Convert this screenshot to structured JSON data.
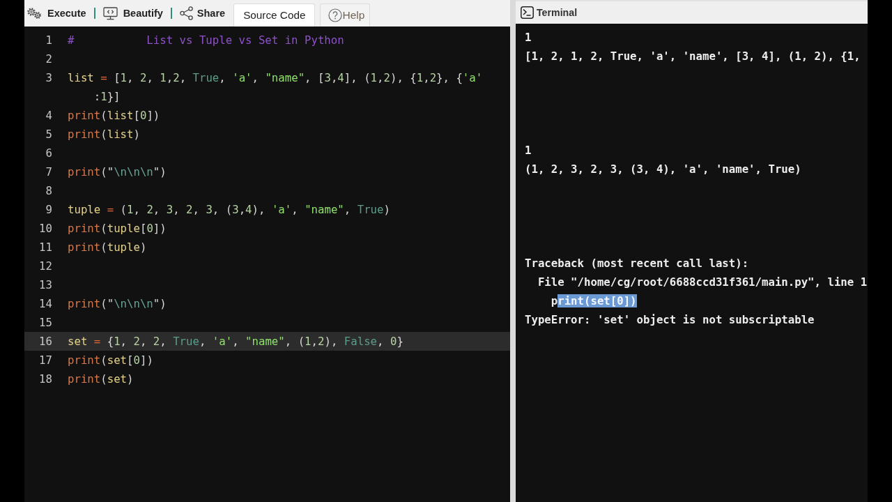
{
  "toolbar": {
    "buttons": [
      {
        "kind": "execute",
        "label": "Execute"
      },
      {
        "kind": "beautify",
        "label": "Beautify"
      },
      {
        "kind": "share",
        "label": "Share"
      }
    ],
    "tabs": [
      {
        "kind": "source",
        "label": "Source Code",
        "selected": true
      },
      {
        "kind": "help",
        "label": "Help",
        "selected": false
      }
    ]
  },
  "editor": {
    "lines": [
      {
        "number": "1",
        "active": false,
        "tokens": [
          {
            "kind": "comment",
            "text": "#           List vs Tuple vs Set in Python"
          }
        ]
      },
      {
        "number": "2",
        "active": false
      },
      {
        "number": "3",
        "active": false,
        "tokens": [
          {
            "kind": "variable",
            "text": "list"
          },
          {
            "kind": "operator",
            "text": " = "
          },
          {
            "kind": "punctuation",
            "text": "["
          },
          {
            "kind": "number",
            "text": "1"
          },
          {
            "kind": "punctuation",
            "text": ", "
          },
          {
            "kind": "number",
            "text": "2"
          },
          {
            "kind": "punctuation",
            "text": ", "
          },
          {
            "kind": "number",
            "text": "1"
          },
          {
            "kind": "punctuation",
            "text": ","
          },
          {
            "kind": "number",
            "text": "2"
          },
          {
            "kind": "punctuation",
            "text": ", "
          },
          {
            "kind": "constant",
            "text": "True"
          },
          {
            "kind": "punctuation",
            "text": ", "
          },
          {
            "kind": "string",
            "text": "'a'"
          },
          {
            "kind": "punctuation",
            "text": ", "
          },
          {
            "kind": "string",
            "text": "\"name\""
          },
          {
            "kind": "punctuation",
            "text": ", ["
          },
          {
            "kind": "number",
            "text": "3"
          },
          {
            "kind": "punctuation",
            "text": ","
          },
          {
            "kind": "number",
            "text": "4"
          },
          {
            "kind": "punctuation",
            "text": "], ("
          },
          {
            "kind": "number",
            "text": "1"
          },
          {
            "kind": "punctuation",
            "text": ","
          },
          {
            "kind": "number",
            "text": "2"
          },
          {
            "kind": "punctuation",
            "text": "), {"
          },
          {
            "kind": "number",
            "text": "1"
          },
          {
            "kind": "punctuation",
            "text": ","
          },
          {
            "kind": "number",
            "text": "2"
          },
          {
            "kind": "punctuation",
            "text": "}, {"
          },
          {
            "kind": "string",
            "text": "'a'"
          },
          {
            "kind": "punctuation",
            "text": ":"
          },
          {
            "kind": "number",
            "text": "1"
          },
          {
            "kind": "punctuation",
            "text": "}]"
          }
        ]
      },
      {
        "number": "4",
        "active": false,
        "tokens": [
          {
            "kind": "builtin",
            "text": "print"
          },
          {
            "kind": "punctuation",
            "text": "("
          },
          {
            "kind": "variable",
            "text": "list"
          },
          {
            "kind": "punctuation",
            "text": "["
          },
          {
            "kind": "number",
            "text": "0"
          },
          {
            "kind": "punctuation",
            "text": "])"
          }
        ]
      },
      {
        "number": "5",
        "active": false,
        "tokens": [
          {
            "kind": "builtin",
            "text": "print"
          },
          {
            "kind": "punctuation",
            "text": "("
          },
          {
            "kind": "variable",
            "text": "list"
          },
          {
            "kind": "punctuation",
            "text": ")"
          }
        ]
      },
      {
        "number": "6",
        "active": false
      },
      {
        "number": "7",
        "active": false,
        "tokens": [
          {
            "kind": "builtin",
            "text": "print"
          },
          {
            "kind": "punctuation",
            "text": "(\""
          },
          {
            "kind": "escape",
            "text": "\\n\\n\\n"
          },
          {
            "kind": "punctuation",
            "text": "\")"
          }
        ]
      },
      {
        "number": "8",
        "active": false
      },
      {
        "number": "9",
        "active": false,
        "tokens": [
          {
            "kind": "variable",
            "text": "tuple"
          },
          {
            "kind": "operator",
            "text": " = "
          },
          {
            "kind": "punctuation",
            "text": "("
          },
          {
            "kind": "number",
            "text": "1"
          },
          {
            "kind": "punctuation",
            "text": ", "
          },
          {
            "kind": "number",
            "text": "2"
          },
          {
            "kind": "punctuation",
            "text": ", "
          },
          {
            "kind": "number",
            "text": "3"
          },
          {
            "kind": "punctuation",
            "text": ", "
          },
          {
            "kind": "number",
            "text": "2"
          },
          {
            "kind": "punctuation",
            "text": ", "
          },
          {
            "kind": "number",
            "text": "3"
          },
          {
            "kind": "punctuation",
            "text": ", ("
          },
          {
            "kind": "number",
            "text": "3"
          },
          {
            "kind": "punctuation",
            "text": ","
          },
          {
            "kind": "number",
            "text": "4"
          },
          {
            "kind": "punctuation",
            "text": "), "
          },
          {
            "kind": "string",
            "text": "'a'"
          },
          {
            "kind": "punctuation",
            "text": ", "
          },
          {
            "kind": "string",
            "text": "\"name\""
          },
          {
            "kind": "punctuation",
            "text": ", "
          },
          {
            "kind": "constant",
            "text": "True"
          },
          {
            "kind": "punctuation",
            "text": ")"
          }
        ]
      },
      {
        "number": "10",
        "active": false,
        "tokens": [
          {
            "kind": "builtin",
            "text": "print"
          },
          {
            "kind": "punctuation",
            "text": "("
          },
          {
            "kind": "variable",
            "text": "tuple"
          },
          {
            "kind": "punctuation",
            "text": "["
          },
          {
            "kind": "number",
            "text": "0"
          },
          {
            "kind": "punctuation",
            "text": "])"
          }
        ]
      },
      {
        "number": "11",
        "active": false,
        "tokens": [
          {
            "kind": "builtin",
            "text": "print"
          },
          {
            "kind": "punctuation",
            "text": "("
          },
          {
            "kind": "variable",
            "text": "tuple"
          },
          {
            "kind": "punctuation",
            "text": ")"
          }
        ]
      },
      {
        "number": "12",
        "active": false
      },
      {
        "number": "13",
        "active": false
      },
      {
        "number": "14",
        "active": false,
        "tokens": [
          {
            "kind": "builtin",
            "text": "print"
          },
          {
            "kind": "punctuation",
            "text": "(\""
          },
          {
            "kind": "escape",
            "text": "\\n\\n\\n"
          },
          {
            "kind": "punctuation",
            "text": "\")"
          }
        ]
      },
      {
        "number": "15",
        "active": false
      },
      {
        "number": "16",
        "active": true,
        "tokens": [
          {
            "kind": "variable",
            "text": "set"
          },
          {
            "kind": "operator",
            "text": " = "
          },
          {
            "kind": "punctuation",
            "text": "{"
          },
          {
            "kind": "number",
            "text": "1"
          },
          {
            "kind": "punctuation",
            "text": ", "
          },
          {
            "kind": "number",
            "text": "2"
          },
          {
            "kind": "punctuation",
            "text": ", "
          },
          {
            "kind": "number",
            "text": "2"
          },
          {
            "kind": "punctuation",
            "text": ", "
          },
          {
            "kind": "constant",
            "text": "True"
          },
          {
            "kind": "punctuation",
            "text": ", "
          },
          {
            "kind": "string",
            "text": "'a'"
          },
          {
            "kind": "punctuation",
            "text": ", "
          },
          {
            "kind": "string",
            "text": "\"name\""
          },
          {
            "kind": "punctuation",
            "text": ", ("
          },
          {
            "kind": "number",
            "text": "1"
          },
          {
            "kind": "punctuation",
            "text": ","
          },
          {
            "kind": "number",
            "text": "2"
          },
          {
            "kind": "punctuation",
            "text": "), "
          },
          {
            "kind": "constant",
            "text": "False"
          },
          {
            "kind": "punctuation",
            "text": ", "
          },
          {
            "kind": "number",
            "text": "0"
          },
          {
            "kind": "punctuation",
            "text": "}"
          }
        ]
      },
      {
        "number": "17",
        "active": false,
        "tokens": [
          {
            "kind": "builtin",
            "text": "print"
          },
          {
            "kind": "punctuation",
            "text": "("
          },
          {
            "kind": "variable",
            "text": "set"
          },
          {
            "kind": "punctuation",
            "text": "["
          },
          {
            "kind": "number",
            "text": "0"
          },
          {
            "kind": "punctuation",
            "text": "])"
          }
        ]
      },
      {
        "number": "18",
        "active": false,
        "tokens": [
          {
            "kind": "builtin",
            "text": "print"
          },
          {
            "kind": "punctuation",
            "text": "("
          },
          {
            "kind": "variable",
            "text": "set"
          },
          {
            "kind": "punctuation",
            "text": ")"
          }
        ]
      }
    ]
  },
  "terminal": {
    "title": "Terminal",
    "output": [
      {
        "lines": [
          {
            "kind": "text",
            "text": "1"
          },
          {
            "kind": "text",
            "text": "[1, 2, 1, 2, True, 'a', 'name', [3, 4], (1, 2), {1,"
          }
        ]
      },
      {
        "lines": [
          {
            "kind": "text",
            "text": "1"
          },
          {
            "kind": "text",
            "text": "(1, 2, 3, 2, 3, (3, 4), 'a', 'name', True)"
          }
        ]
      },
      {
        "lines": [
          {
            "kind": "text",
            "text": "Traceback (most recent call last):"
          },
          {
            "kind": "frame",
            "text": "File \"/home/cg/root/6688ccd31f361/main.py\", line 1"
          },
          {
            "kind": "source",
            "segments": [
              {
                "text": "p",
                "selected": false
              },
              {
                "text": "rint(set[0])",
                "selected": true
              }
            ]
          },
          {
            "kind": "text",
            "text": "TypeError: 'set' object is not subscriptable"
          }
        ]
      }
    ]
  }
}
